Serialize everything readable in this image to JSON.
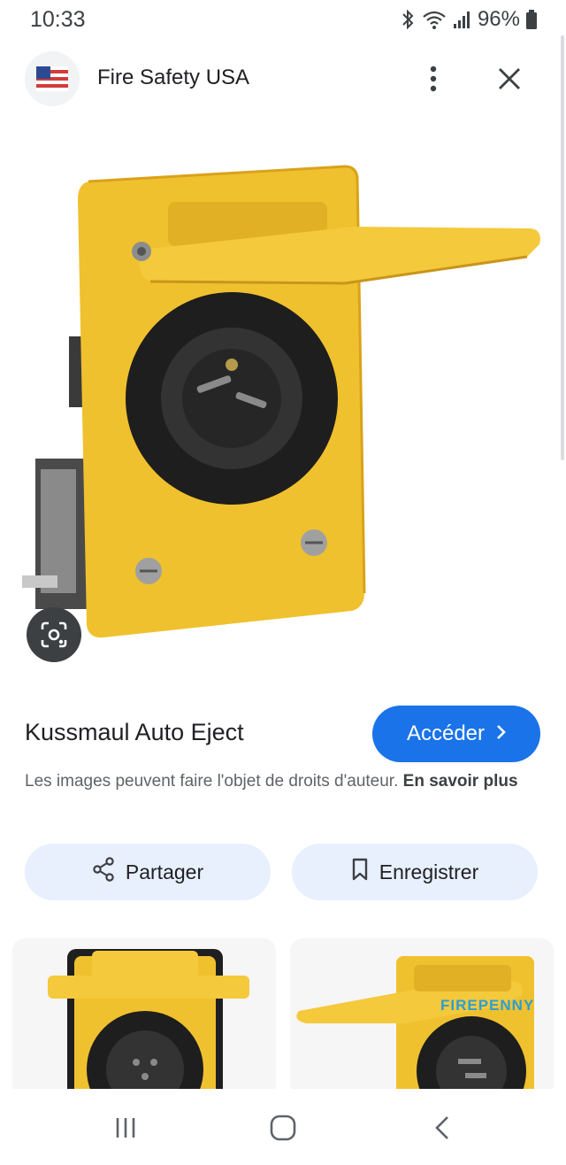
{
  "status_bar": {
    "time": "10:33",
    "battery": "96%",
    "icons": [
      "bluetooth-icon",
      "wifi-icon",
      "signal-icon",
      "battery-icon"
    ]
  },
  "header": {
    "site_name": "Fire Safety USA",
    "favicon": "us-flag-icon",
    "more_icon": "more-vert-icon",
    "close_icon": "close-icon"
  },
  "result": {
    "title": "Kussmaul Auto Eject",
    "visit_label": "Accéder",
    "copyright_text": "Les images peuvent faire l'objet de droits d'auteur.",
    "learn_more": "En savoir plus"
  },
  "actions": {
    "share_label": "Partager",
    "save_label": "Enregistrer"
  },
  "related": {
    "watermark": "FIREPENNY"
  },
  "nav": {
    "icons": [
      "recents-icon",
      "home-icon",
      "back-icon"
    ]
  },
  "colors": {
    "accent": "#1a73e8",
    "chip": "#e8f0fe",
    "product_yellow": "#f0c12e"
  }
}
